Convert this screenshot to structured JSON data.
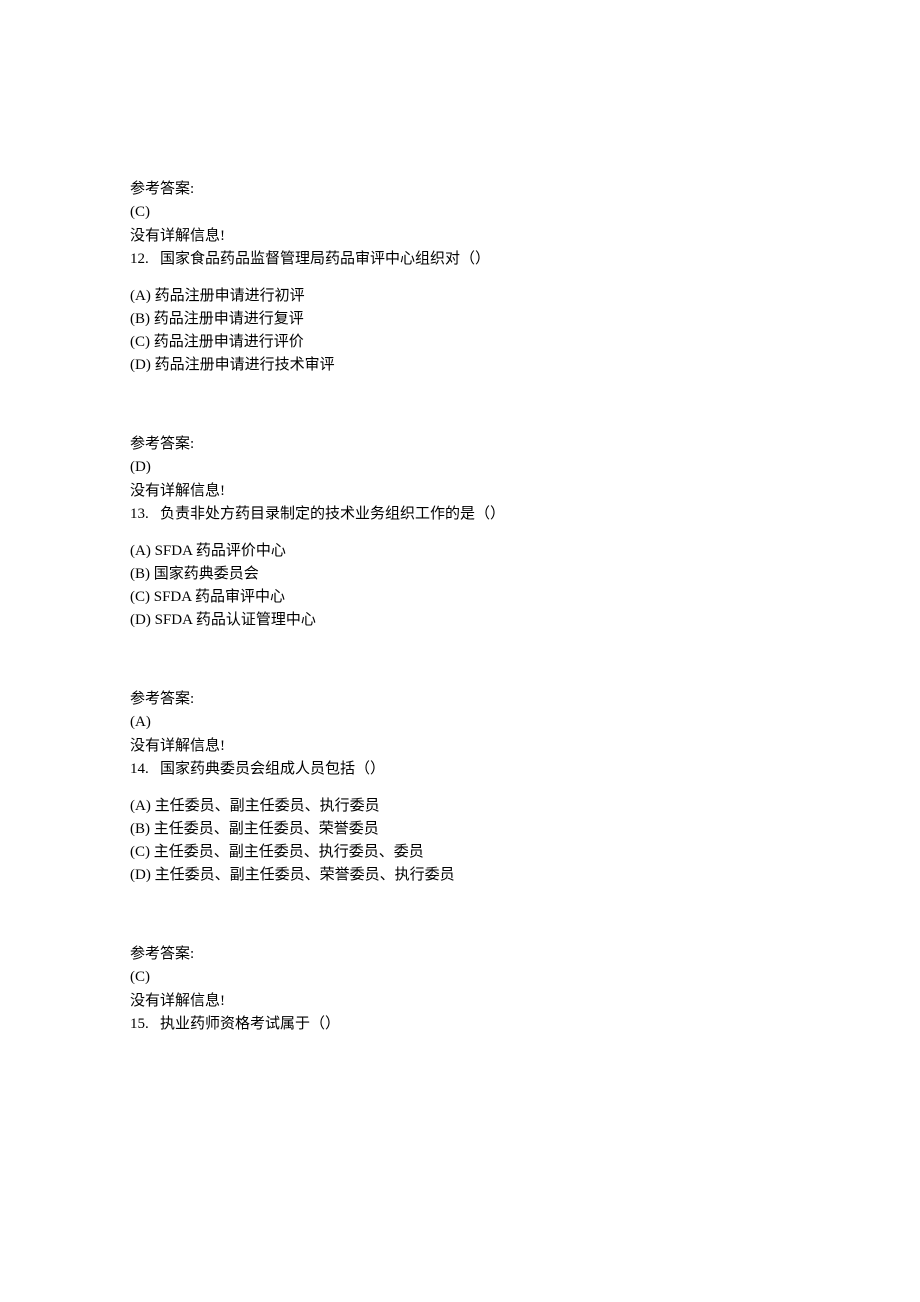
{
  "blocks": [
    {
      "answerHeader": "参考答案:",
      "answer": "(C)",
      "noDetail": "没有详解信息!",
      "questionNum": "12.",
      "questionText": "国家食品药品监督管理局药品审评中心组织对（）",
      "options": [
        "(A) 药品注册申请进行初评",
        "(B) 药品注册申请进行复评",
        "(C) 药品注册申请进行评价",
        "(D) 药品注册申请进行技术审评"
      ]
    },
    {
      "answerHeader": "参考答案:",
      "answer": "(D)",
      "noDetail": "没有详解信息!",
      "questionNum": "13.",
      "questionText": "负责非处方药目录制定的技术业务组织工作的是（）",
      "options": [
        "(A) SFDA 药品评价中心",
        "(B) 国家药典委员会",
        "(C) SFDA 药品审评中心",
        "(D) SFDA 药品认证管理中心"
      ]
    },
    {
      "answerHeader": "参考答案:",
      "answer": "(A)",
      "noDetail": "没有详解信息!",
      "questionNum": "14.",
      "questionText": "国家药典委员会组成人员包括（）",
      "options": [
        "(A) 主任委员、副主任委员、执行委员",
        "(B) 主任委员、副主任委员、荣誉委员",
        "(C) 主任委员、副主任委员、执行委员、委员",
        "(D) 主任委员、副主任委员、荣誉委员、执行委员"
      ]
    },
    {
      "answerHeader": "参考答案:",
      "answer": "(C)",
      "noDetail": "没有详解信息!",
      "questionNum": "15.",
      "questionText": "执业药师资格考试属于（）",
      "options": []
    }
  ]
}
